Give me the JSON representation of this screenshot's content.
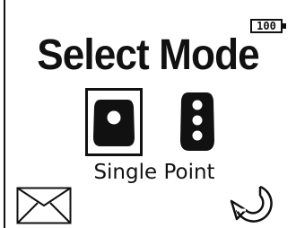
{
  "status": {
    "battery_level": "100",
    "battery_icon": "battery-icon"
  },
  "header": {
    "title": "Select Mode"
  },
  "modes": {
    "items": [
      {
        "icon": "single-point-icon",
        "label": "Single Point",
        "selected": true
      },
      {
        "icon": "three-point-icon",
        "label": "",
        "selected": false
      }
    ],
    "selected_label": "Single Point"
  },
  "footer": {
    "message_icon": "envelope-icon",
    "back_icon": "back-arrow-icon"
  }
}
